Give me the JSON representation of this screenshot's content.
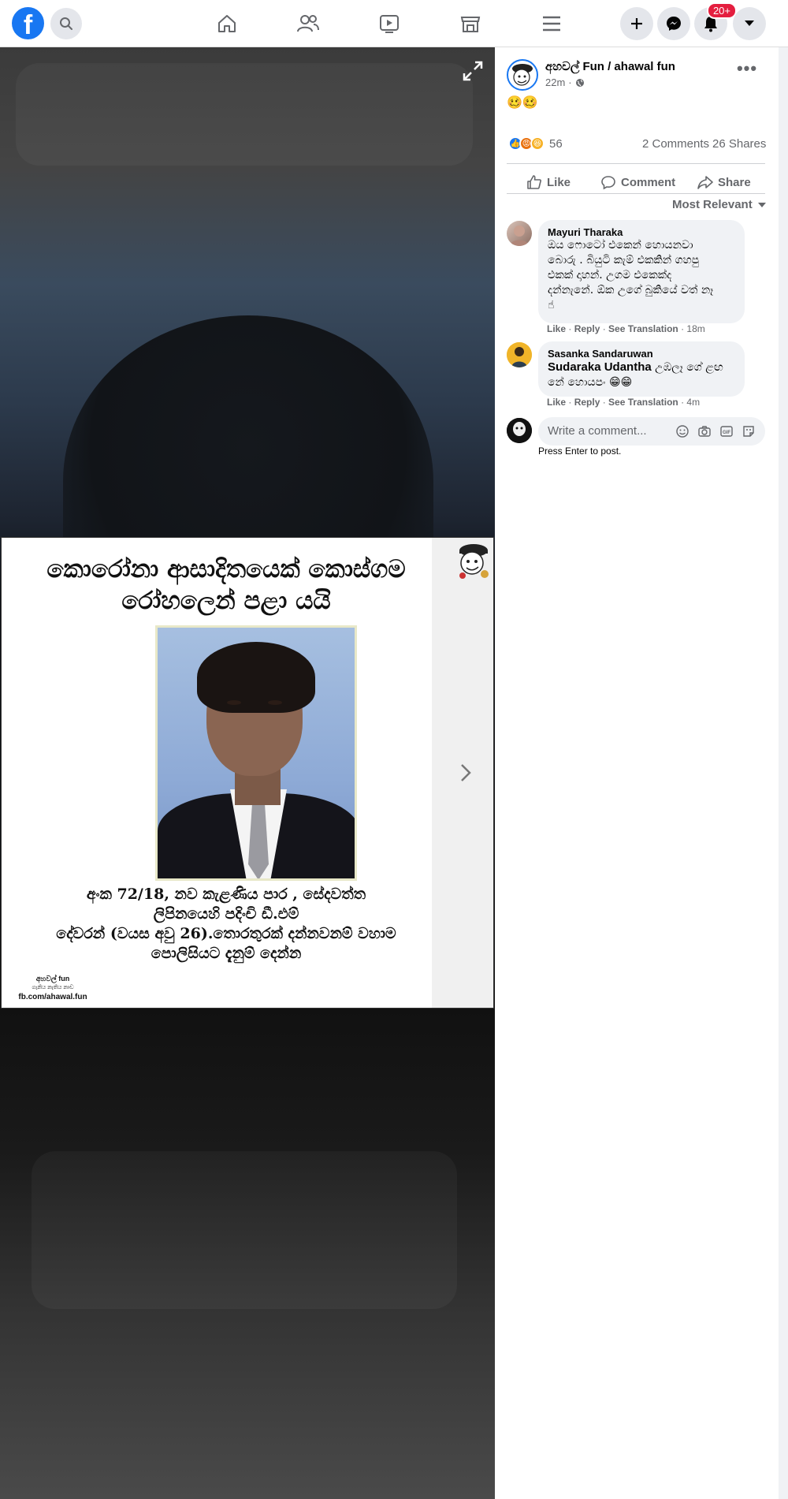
{
  "topbar": {
    "logo": "f",
    "notifications_badge": "20+",
    "icons": [
      "facebook-logo",
      "search-icon",
      "home-icon",
      "friends-icon",
      "watch-icon",
      "marketplace-icon",
      "menu-icon",
      "plus-icon",
      "messenger-icon",
      "bell-icon",
      "chevron-down-icon"
    ]
  },
  "photo": {
    "poster": {
      "title_line1": "කොරෝනා ආසාදිතයෙක් කොස්ගම",
      "title_line2": "රෝහලෙන් පළා යයි",
      "body_line1": "අංක 72/18, නව කැළණිය පාර , සේදවත්ත",
      "body_line2": "ලිපිනයෙහි පදිංචි ඩී.එම්",
      "body_line3": "දේවරන් (වයස අවු 26).තොරතුරක් දන්නවනම් වහාම",
      "body_line4": "පොලිසියට දැනුම් දෙන්න",
      "footer_brand": "අහවල් fun",
      "footer_tagline": "ගැනිය නැතිය නාඩ",
      "footer_url": "fb.com/ahawal.fun"
    }
  },
  "post": {
    "author": "අහවල් Fun / ahawal fun",
    "time": "22m",
    "text": "🥴🥴",
    "reaction_count": "56",
    "comments": "2 Comments",
    "shares": "26 Shares",
    "like_label": "Like",
    "comment_label": "Comment",
    "share_label": "Share",
    "sort_label": "Most Relevant"
  },
  "comments": [
    {
      "name": "Mayuri Tharaka",
      "lines": [
        "ඔය ෆොටෝ එකෙන් හොයනවා",
        "බොරු . බියුටි කැම් එකකින් ගහපු",
        "එකක් දාහන්. උගම එකෙක්ද",
        "දන්නැනේ. ඕක උගේ බුකියේ වත් නෑ",
        "☝"
      ],
      "like": "Like",
      "reply": "Reply",
      "translate": "See Translation",
      "time": "18m"
    },
    {
      "name": "Sasanka Sandaruwan",
      "mention": "Sudaraka Udantha",
      "line1_rest": " උඹලෑ ගේ ළඟ",
      "line2": "නේ හොයපං 😁😁",
      "like": "Like",
      "reply": "Reply",
      "translate": "See Translation",
      "time": "4m"
    }
  ],
  "composer": {
    "placeholder": "Write a comment...",
    "hint": "Press Enter to post."
  }
}
